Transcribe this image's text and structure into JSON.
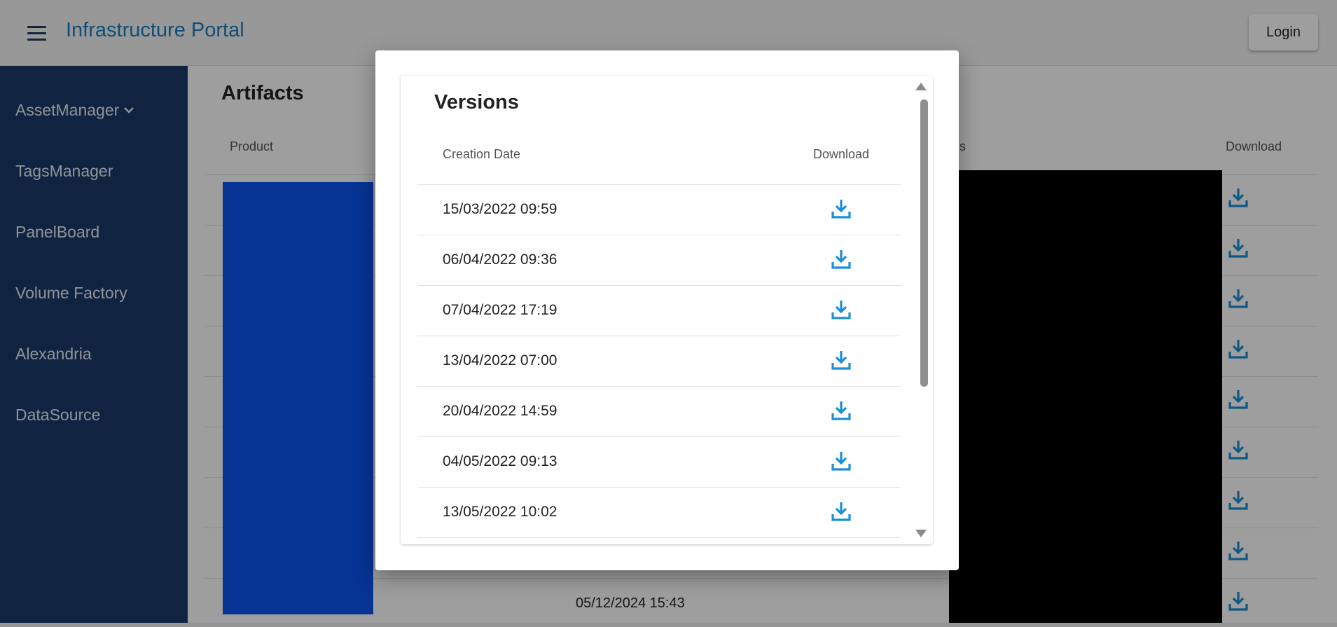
{
  "app": {
    "title": "Infrastructure Portal",
    "login_label": "Login",
    "menu_icon": "hamburger-menu-icon",
    "accent_color": "#1a7fc0"
  },
  "sidebar": {
    "items": [
      {
        "label": "AssetManager",
        "has_dropdown": true
      },
      {
        "label": "TagsManager"
      },
      {
        "label": "PanelBoard"
      },
      {
        "label": "Volume Factory"
      },
      {
        "label": "Alexandria"
      },
      {
        "label": "DataSource"
      }
    ]
  },
  "main": {
    "title": "Artifacts",
    "columns": {
      "product": "Product",
      "tags": "ags",
      "download": "Download"
    },
    "visible_date": "05/12/2024 15:43"
  },
  "modal": {
    "title": "Versions",
    "columns": {
      "creation_date": "Creation Date",
      "download": "Download"
    },
    "versions": [
      {
        "date": "15/03/2022 09:59"
      },
      {
        "date": "06/04/2022 09:36"
      },
      {
        "date": "07/04/2022 17:19"
      },
      {
        "date": "13/04/2022 07:00"
      },
      {
        "date": "20/04/2022 14:59"
      },
      {
        "date": "04/05/2022 09:13"
      },
      {
        "date": "13/05/2022 10:02"
      }
    ]
  }
}
